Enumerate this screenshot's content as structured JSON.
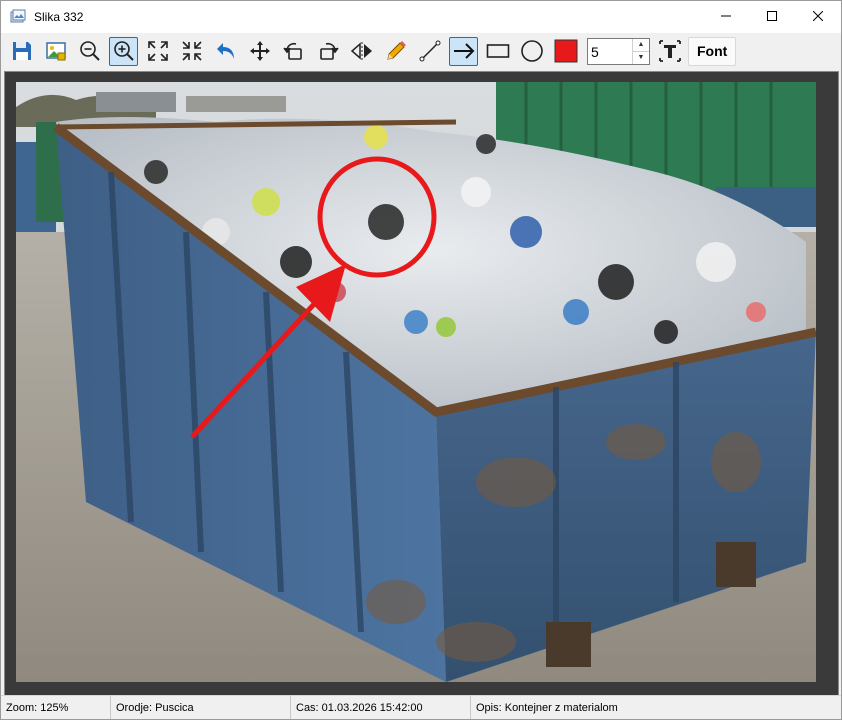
{
  "window": {
    "title": "Slika 332"
  },
  "toolbar": {
    "buttons": [
      {
        "icon": "save-icon"
      },
      {
        "icon": "image-icon"
      },
      {
        "icon": "zoom-out-icon"
      },
      {
        "icon": "zoom-in-icon"
      },
      {
        "icon": "fit-window-icon"
      },
      {
        "icon": "actual-size-icon"
      },
      {
        "icon": "undo-icon"
      },
      {
        "icon": "move-icon"
      },
      {
        "icon": "rotate-left-icon"
      },
      {
        "icon": "rotate-right-icon"
      },
      {
        "icon": "flip-icon"
      },
      {
        "icon": "pencil-icon"
      },
      {
        "icon": "line-icon"
      },
      {
        "icon": "arrow-icon",
        "active": true
      },
      {
        "icon": "rectangle-icon"
      },
      {
        "icon": "ellipse-icon"
      },
      {
        "icon": "color-icon"
      }
    ],
    "stroke_width": "5",
    "text_button_icon": "text-icon",
    "font_label": "Font",
    "selected_color": "#e8191b",
    "accent": "#0078d7"
  },
  "annotations": {
    "circle_color": "#e8191b",
    "arrow_color": "#e8191b"
  },
  "status": {
    "zoom": "Zoom: 125%",
    "tool": "Orodje: Puscica",
    "time": "Cas: 01.03.2026 15:42:00",
    "description": "Opis: Kontejner z materialom"
  }
}
